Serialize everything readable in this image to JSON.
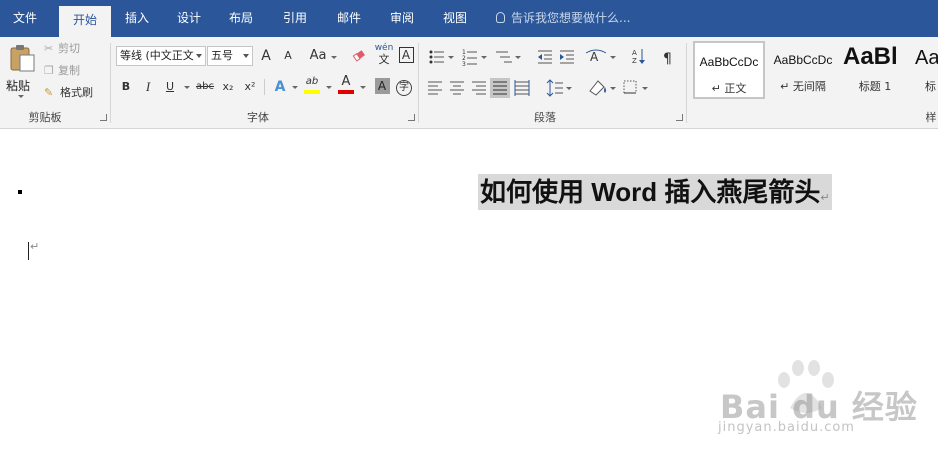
{
  "tabs": [
    "文件",
    "开始",
    "插入",
    "设计",
    "布局",
    "引用",
    "邮件",
    "审阅",
    "视图"
  ],
  "active_tab": "开始",
  "tell_me": "告诉我您想要做什么...",
  "clipboard": {
    "paste": "粘贴",
    "cut": "剪切",
    "copy": "复制",
    "format_painter": "格式刷",
    "label": "剪贴板"
  },
  "font": {
    "family": "等线 (中文正文",
    "size": "五号",
    "change_case": "Aa",
    "phonetic": "wén",
    "phonetic_char": "文",
    "bold": "B",
    "italic": "I",
    "underline": "U",
    "strike": "abc",
    "subscript": "x₂",
    "superscript": "x²",
    "text_effect": "A",
    "highlight": "ab",
    "font_color": "A",
    "char_shading": "A",
    "enclose": "字",
    "grow": "A",
    "shrink": "A",
    "label": "字体"
  },
  "paragraph": {
    "label": "段落"
  },
  "styles": [
    {
      "sample": "AaBbCcDc",
      "name": "↵ 正文"
    },
    {
      "sample": "AaBbCcDc",
      "name": "↵ 无间隔"
    },
    {
      "sample": "AaBl",
      "name": "标题 1"
    },
    {
      "sample": "Aa",
      "name": "标"
    }
  ],
  "styles_label": "样",
  "document": {
    "heading": "如何使用 Word 插入燕尾箭头",
    "para_mark": "↵"
  },
  "watermark": {
    "brand": "Bai du 经验",
    "url": "jingyan.baidu.com"
  },
  "colors": {
    "titlebar": "#2b579a",
    "ribbon": "#f3f3f3",
    "highlight": "#ffff00",
    "font_color": "#e00000",
    "selection": "#d9d9d9"
  }
}
